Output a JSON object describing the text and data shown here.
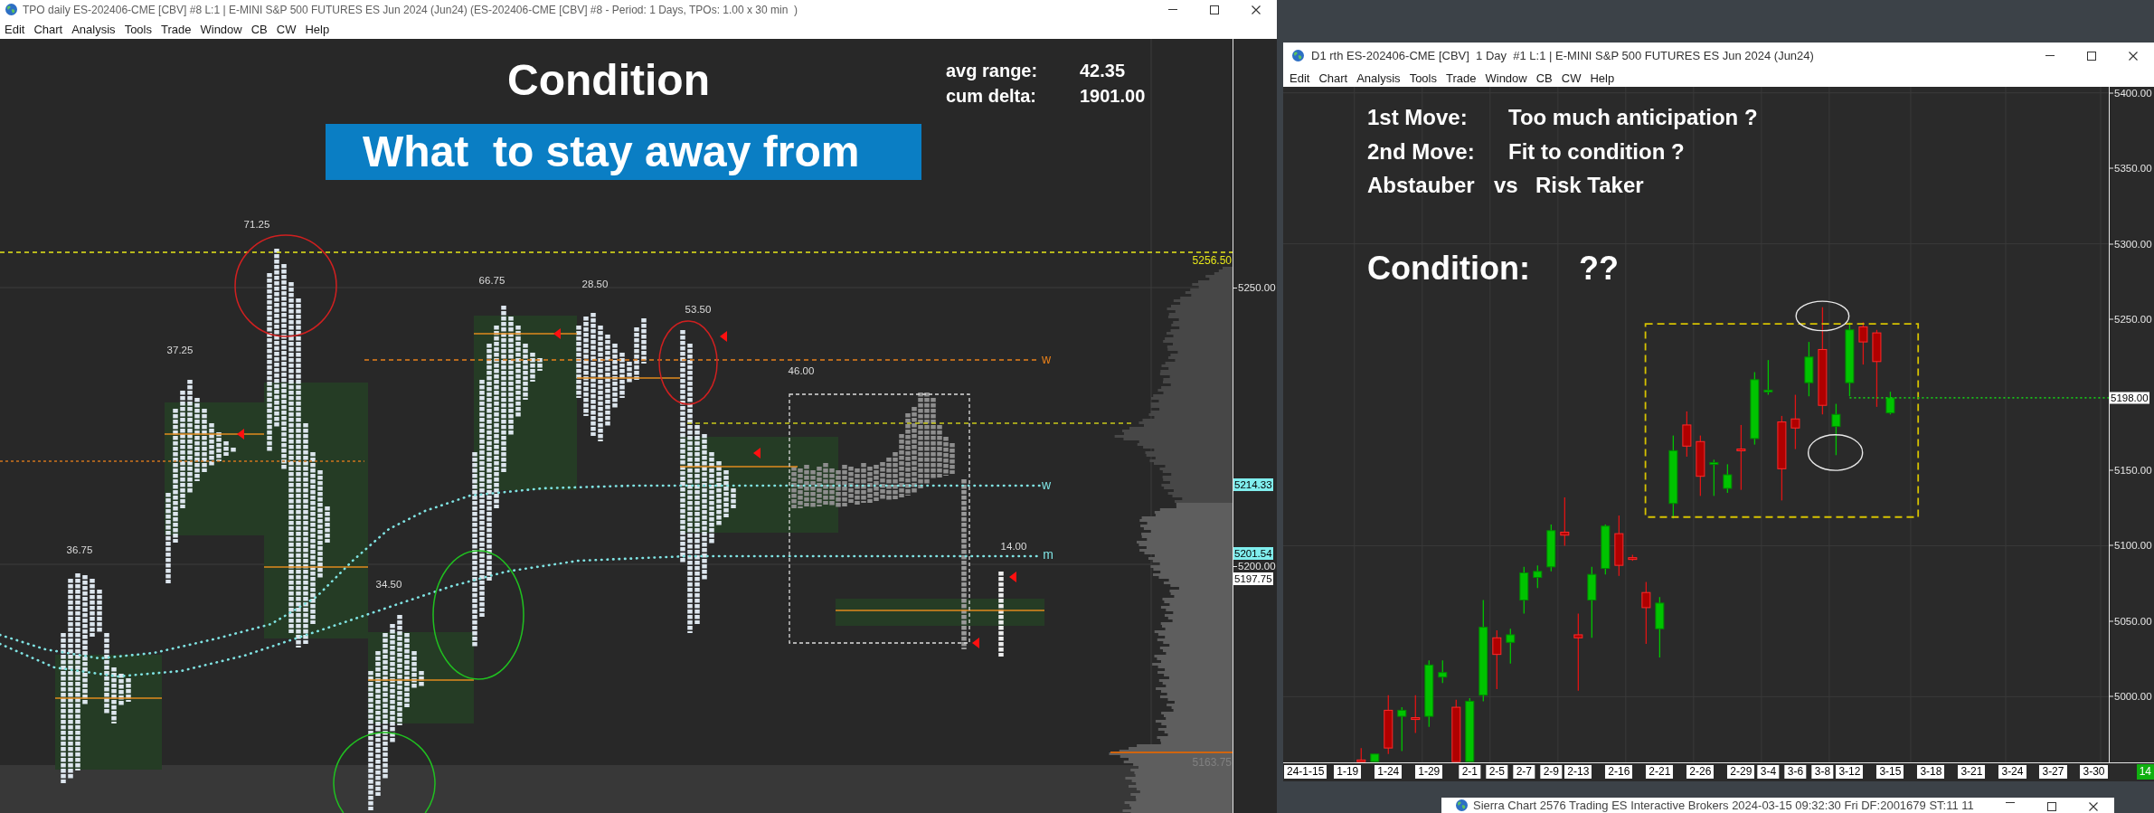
{
  "tpo_window": {
    "title": "TPO daily ES-202406-CME [CBV] #8 L:1 | E-MINI S&P 500 FUTURES ES Jun 2024 (Jun24) (ES-202406-CME [CBV] #8 - Period: 1 Days, TPOs: 1.00 x 30 min  )",
    "menu": [
      "Edit",
      "Chart",
      "Analysis",
      "Tools",
      "Trade",
      "Window",
      "CB",
      "CW",
      "Help"
    ],
    "chart": {
      "heading": "Condition",
      "banner": "What  to stay away from",
      "stats": [
        {
          "label": "avg range:",
          "value": "42.35"
        },
        {
          "label": "cum delta:",
          "value": "1901.00"
        }
      ],
      "range_labels": [
        "71.25",
        "37.25",
        "66.75",
        "28.50",
        "53.50",
        "46.00",
        "36.75",
        "34.50",
        "14.00"
      ],
      "line_labels": [
        {
          "text": "w",
          "color": "#e8801a"
        },
        {
          "text": "w",
          "color": "#7fe3e3"
        },
        {
          "text": "m",
          "color": "#7fe3e3"
        }
      ],
      "level_labels": [
        {
          "text": "5256.50",
          "color": "#e6e619"
        },
        {
          "text": "5163.75",
          "color": "#808080"
        }
      ],
      "price_axis": [
        {
          "text": "5250.00",
          "kind": "tick"
        },
        {
          "text": "5214.33",
          "kind": "study"
        },
        {
          "text": "5201.54",
          "kind": "study"
        },
        {
          "text": "5200.00",
          "kind": "tick"
        },
        {
          "text": "5197.75",
          "kind": "last"
        }
      ]
    }
  },
  "chart_window": {
    "title": "D1 rth ES-202406-CME [CBV]  1 Day  #1 L:1 | E-MINI S&P 500 FUTURES ES Jun 2024 (Jun24)",
    "menu": [
      "Edit",
      "Chart",
      "Analysis",
      "Tools",
      "Trade",
      "Window",
      "CB",
      "CW",
      "Help"
    ],
    "notes": [
      [
        "1st Move:",
        "Too much anticipation ?"
      ],
      [
        "2nd Move:",
        "Fit to condition ?"
      ],
      [
        "Abstauber",
        "vs",
        "Risk Taker"
      ]
    ],
    "condition": [
      "Condition:",
      "??"
    ],
    "chart_data": {
      "type": "candlestick",
      "grid": true,
      "categories": [
        "24-1-15",
        null,
        null,
        null,
        "1-19",
        null,
        null,
        "1-24",
        null,
        null,
        "1-29",
        null,
        null,
        "2-1",
        null,
        "2-5",
        null,
        "2-7",
        null,
        "2-9",
        null,
        "2-13",
        null,
        null,
        "2-16",
        null,
        null,
        "2-21",
        null,
        null,
        "2-26",
        null,
        null,
        "2-29",
        null,
        "3-4",
        null,
        "3-6",
        null,
        "3-8",
        null,
        "3-12",
        null,
        null,
        "3-15",
        null,
        null,
        "3-18",
        null,
        null,
        "3-21",
        null,
        null,
        "3-24",
        null,
        null,
        "3-27",
        null,
        null,
        "3-30"
      ],
      "ohlc": [
        null,
        null,
        null,
        null,
        null,
        [
          4958,
          4966,
          4957,
          4957
        ],
        [
          4957,
          4962,
          4957,
          4962
        ],
        [
          4991,
          5001,
          4962,
          4966
        ],
        [
          4987,
          4993,
          4964,
          4991
        ],
        [
          4986,
          5001,
          4976,
          4985
        ],
        [
          4987,
          5024,
          4980,
          5021
        ],
        [
          5013,
          5024,
          5009,
          5016
        ],
        [
          4993,
          4998,
          4957,
          4957
        ],
        [
          4957,
          4999,
          4957,
          4997
        ],
        [
          5001,
          5064,
          4997,
          5046
        ],
        [
          5039,
          5044,
          5005,
          5028
        ],
        [
          5036,
          5045,
          5022,
          5041
        ],
        [
          5064,
          5086,
          5055,
          5082
        ],
        [
          5079,
          5087,
          5072,
          5083
        ],
        [
          5086,
          5114,
          5083,
          5110
        ],
        [
          5109,
          5132,
          5100,
          5107
        ],
        [
          5041,
          5055,
          5004,
          5039
        ],
        [
          5064,
          5086,
          5039,
          5081
        ],
        [
          5085,
          5114,
          5081,
          5113
        ],
        [
          5108,
          5120,
          5080,
          5087
        ],
        [
          5092,
          5094,
          5090,
          5091
        ],
        [
          5069,
          5076,
          5035,
          5059
        ],
        [
          5045,
          5066,
          5026,
          5062
        ],
        [
          5128,
          5173,
          5118,
          5163
        ],
        [
          5180,
          5189,
          5159,
          5166
        ],
        [
          5169,
          5173,
          5133,
          5146
        ],
        [
          5154,
          5157,
          5133,
          5155
        ],
        [
          5138,
          5154,
          5135,
          5147
        ],
        [
          5164,
          5180,
          5137,
          5163
        ],
        [
          5171,
          5215,
          5167,
          5210
        ],
        [
          5202,
          5223,
          5200,
          5203
        ],
        [
          5182,
          5186,
          5130,
          5151
        ],
        [
          5184,
          5200,
          5164,
          5178
        ],
        [
          5208,
          5235,
          5199,
          5225
        ],
        [
          5230,
          5258,
          5187,
          5193
        ],
        [
          5179,
          5194,
          5160,
          5187
        ],
        [
          5208,
          5248,
          5199,
          5243
        ],
        [
          5245,
          5248,
          5220,
          5235
        ],
        [
          5241,
          5243,
          5192,
          5222
        ],
        [
          5188,
          5202,
          5187,
          5198
        ],
        null,
        null,
        null,
        null,
        null,
        null,
        null,
        null,
        null,
        null,
        null,
        null,
        null,
        null,
        null
      ],
      "ylim": [
        4956.5,
        5404
      ],
      "yticks": [
        {
          "value": 5400,
          "label": "5400.00"
        },
        {
          "value": 5350,
          "label": "5350.00"
        },
        {
          "value": 5300,
          "label": "5300.00"
        },
        {
          "value": 5250,
          "label": "5250.00"
        },
        {
          "value": 5150,
          "label": "5150.00"
        },
        {
          "value": 5100,
          "label": "5100.00"
        },
        {
          "value": 5050,
          "label": "5050.00"
        },
        {
          "value": 5000,
          "label": "5000.00"
        }
      ],
      "ref_lines": [
        {
          "axis": "y",
          "value": 5198,
          "label": "5198.00"
        }
      ]
    },
    "corner_badge": "14"
  },
  "background_window": {
    "title": "Sierra Chart 2576 Trading ES Interactive Brokers 2024-03-15 09:32:30 Fri DF:2001679 ST:11 11"
  }
}
